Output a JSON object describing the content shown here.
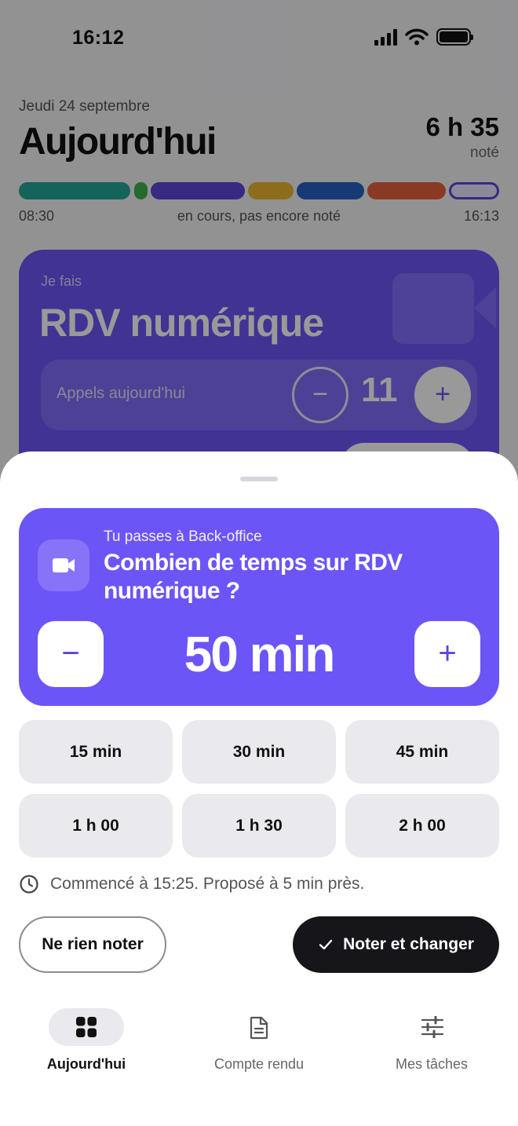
{
  "status_bar": {
    "time": "16:12"
  },
  "today": {
    "date": "Jeudi 24 septembre",
    "title": "Aujourd'hui",
    "total_hours": "6 h 35",
    "total_label": "noté",
    "timeline": {
      "start": "08:30",
      "status": "en cours, pas encore noté",
      "end": "16:13",
      "colors": [
        "#24a597",
        "#3fb04f",
        "#5a47d8",
        "#e9b531",
        "#2761c4",
        "#e4613f",
        "#5a47d8"
      ]
    }
  },
  "current_task": {
    "kicker": "Je fais",
    "name": "RDV numérique",
    "counter_label": "Appels aujourd'hui",
    "counter_value": "11",
    "minus_symbol": "−",
    "plus_symbol": "+"
  },
  "sheet": {
    "kicker": "Tu passes à Back-office",
    "question": "Combien de temps sur RDV numérique ?",
    "duration": "50 min",
    "minus_symbol": "−",
    "plus_symbol": "+",
    "presets": [
      "15 min",
      "30 min",
      "45 min",
      "1 h 00",
      "1 h 30",
      "2 h 00"
    ],
    "started_info": "Commencé à 15:25. Proposé à 5 min près.",
    "skip_label": "Ne rien noter",
    "confirm_label": "Noter et changer",
    "accent_color": "#6c55f7"
  },
  "nav": {
    "today": "Aujourd'hui",
    "report": "Compte rendu",
    "tasks": "Mes tâches"
  }
}
